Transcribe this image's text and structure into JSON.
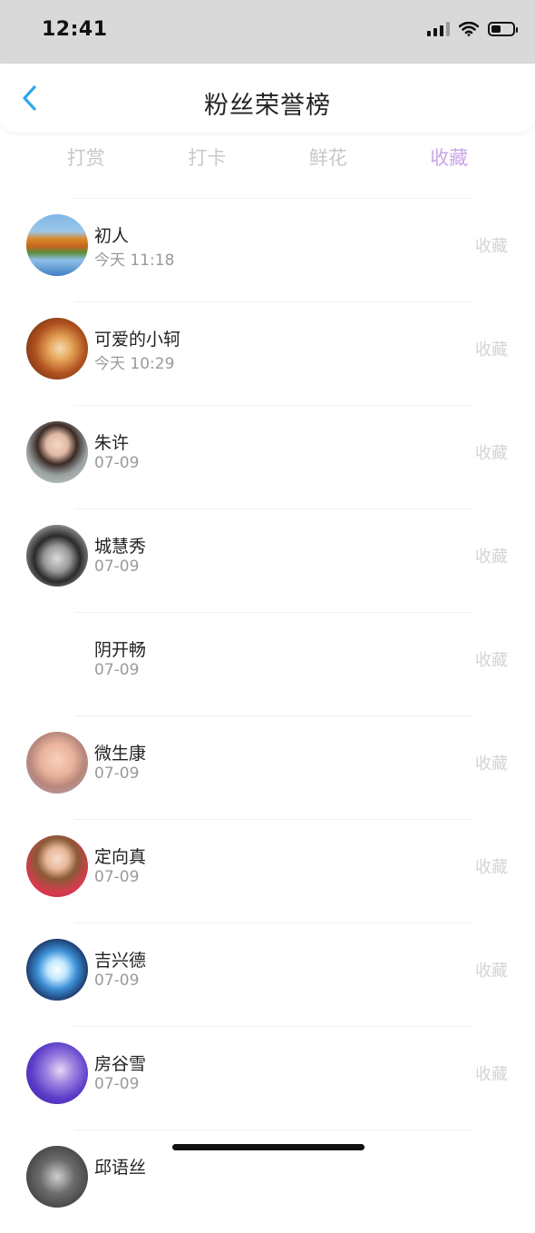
{
  "status_bar": {
    "time": "12:41"
  },
  "nav": {
    "title": "粉丝荣誉榜",
    "back_icon": "chevron-left-icon"
  },
  "tabs": [
    {
      "label": "打赏",
      "active": false
    },
    {
      "label": "打卡",
      "active": false
    },
    {
      "label": "鲜花",
      "active": false
    },
    {
      "label": "收藏",
      "active": true
    }
  ],
  "colors": {
    "accent": "#c9a6e6",
    "back_icon": "#2fa8e8"
  },
  "items": [
    {
      "name": "初人",
      "date": "今天 11:18",
      "action": "收藏",
      "avatar": "landscape"
    },
    {
      "name": "可爱的小轲",
      "date": "今天 10:29",
      "action": "收藏",
      "avatar": "fox"
    },
    {
      "name": "朱许",
      "date": "07-09",
      "action": "收藏",
      "avatar": "girl"
    },
    {
      "name": "城慧秀",
      "date": "07-09",
      "action": "收藏",
      "avatar": "bw-boy"
    },
    {
      "name": "阴开畅",
      "date": "07-09",
      "action": "收藏",
      "avatar": "none"
    },
    {
      "name": "微生康",
      "date": "07-09",
      "action": "收藏",
      "avatar": "baby"
    },
    {
      "name": "定向真",
      "date": "07-09",
      "action": "收藏",
      "avatar": "woman-red"
    },
    {
      "name": "吉兴德",
      "date": "07-09",
      "action": "收藏",
      "avatar": "anime"
    },
    {
      "name": "房谷雪",
      "date": "07-09",
      "action": "收藏",
      "avatar": "purple"
    },
    {
      "name": "邱语丝",
      "date": "",
      "action": "",
      "avatar": "bw"
    }
  ]
}
